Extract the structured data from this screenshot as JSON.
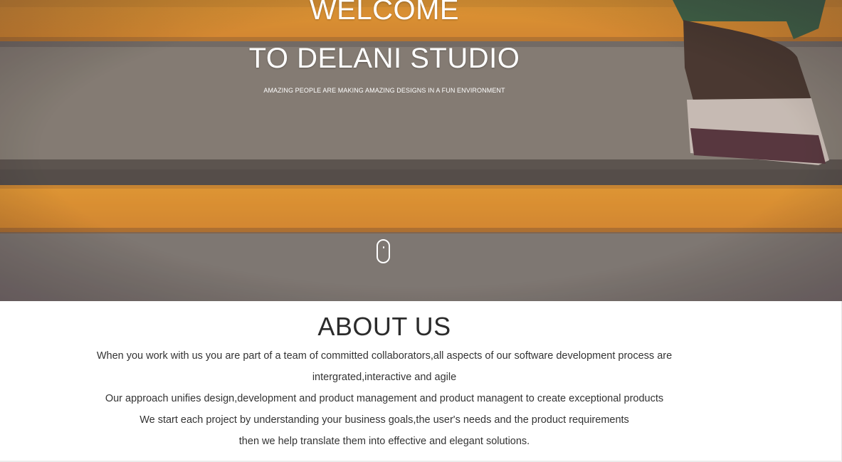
{
  "hero": {
    "welcome": "WELCOME",
    "title": "TO DELANI STUDIO",
    "tagline": "AMAZING PEOPLE ARE MAKING AMAZING DESIGNS IN A FUN ENVIRONMENT",
    "scroll_icon": "mouse-scroll-icon"
  },
  "about": {
    "title": "ABOUT US",
    "paragraphs": [
      "When you work with us you are part of a team of committed collaborators,all aspects of our software development process are intergrated,interactive and agile",
      "Our approach unifies design,development and product management and product managent to create exceptional products",
      "We start each project by understanding your business goals,the user's needs and the product requirements",
      "then we help translate them into effective and elegant solutions."
    ]
  },
  "colors": {
    "stair_orange": "#f0a033",
    "concrete_gray": "#8f8b80",
    "text_dark": "#333333"
  }
}
